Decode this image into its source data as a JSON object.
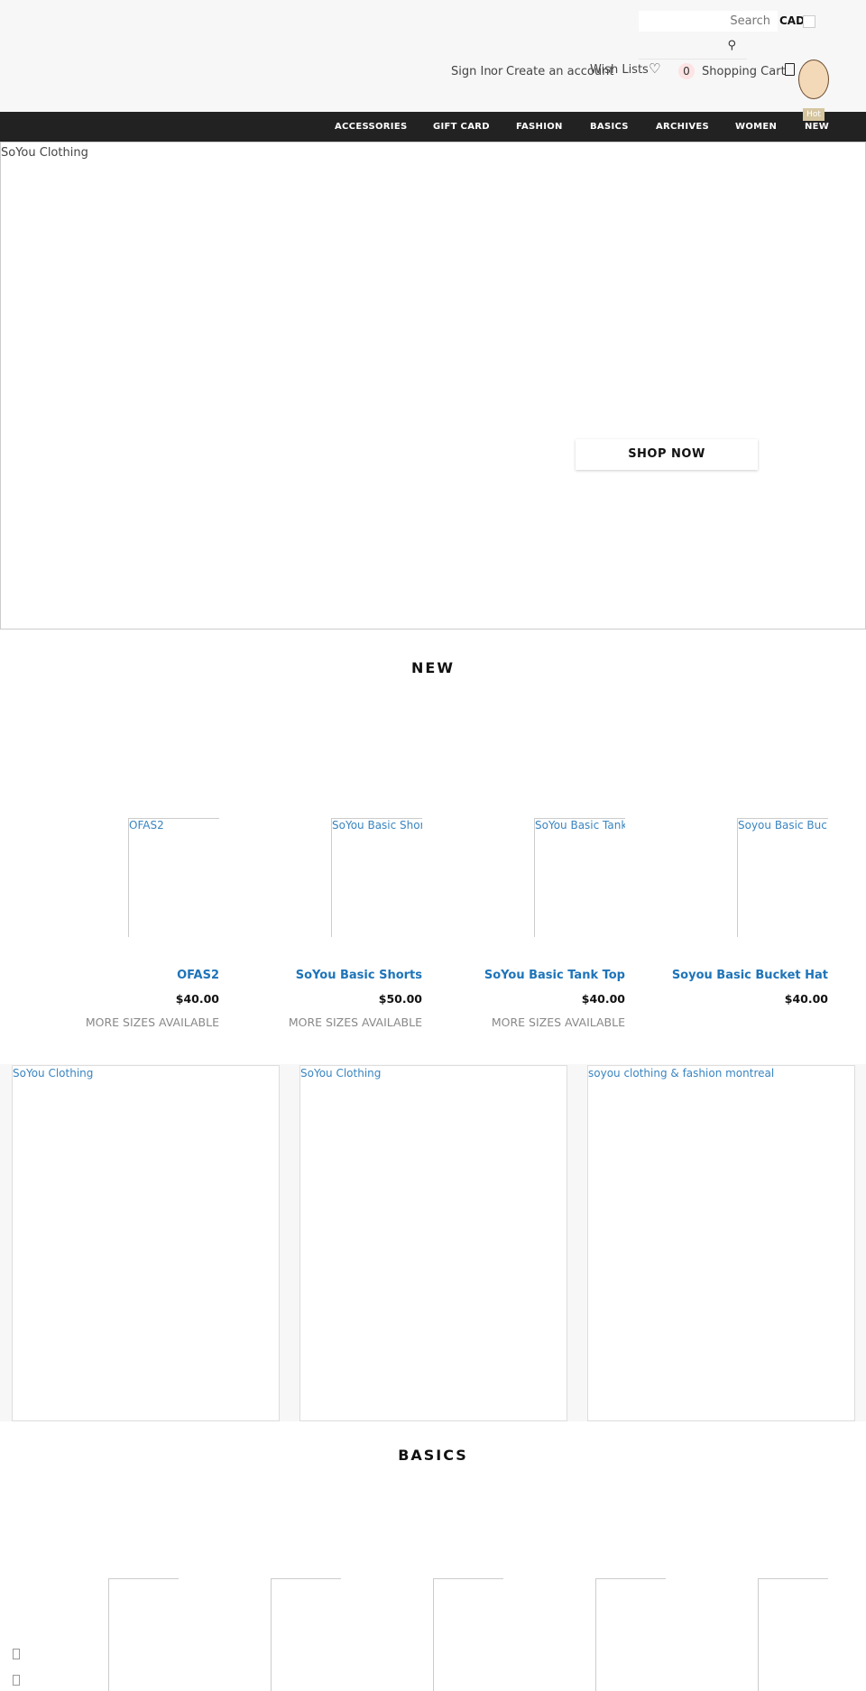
{
  "header": {
    "search_placeholder": "Search",
    "currency": "CAD",
    "sign_in": "Sign In",
    "or": "or",
    "create_account": "Create an account",
    "wish_lists": "Wish Lists",
    "cart_count": "0",
    "shopping_cart": "Shopping Cart",
    "hot_badge": "Hot"
  },
  "nav": {
    "items": [
      "ACCESSORIES",
      "GIFT CARD",
      "FASHION",
      "BASICS",
      "ARCHIVES",
      "WOMEN",
      "NEW"
    ]
  },
  "hero": {
    "image_alt": "SoYou Clothing",
    "cta": "SHOP NOW"
  },
  "new_section": {
    "title": "NEW",
    "products": [
      {
        "image_alt": "OFAS2",
        "title": "OFAS2",
        "price": "$40.00",
        "note": "MORE SIZES AVAILABLE"
      },
      {
        "image_alt": "SoYou Basic Shorts",
        "title": "SoYou Basic Shorts",
        "price": "$50.00",
        "note": "MORE SIZES AVAILABLE"
      },
      {
        "image_alt": "SoYou Basic Tank Top",
        "title": "SoYou Basic Tank Top",
        "price": "$40.00",
        "note": "MORE SIZES AVAILABLE"
      },
      {
        "image_alt": "Soyou Basic Bucket Hat",
        "title": "Soyou Basic Bucket Hat",
        "price": "$40.00"
      }
    ]
  },
  "banners": [
    "SoYou Clothing",
    "SoYou Clothing",
    "soyou clothing & fashion montreal"
  ],
  "basics_section": {
    "title": "BASICS"
  },
  "colors": {
    "nav_bg": "#222222",
    "link": "#1e74b9",
    "header_bg": "#f7f7f7"
  }
}
